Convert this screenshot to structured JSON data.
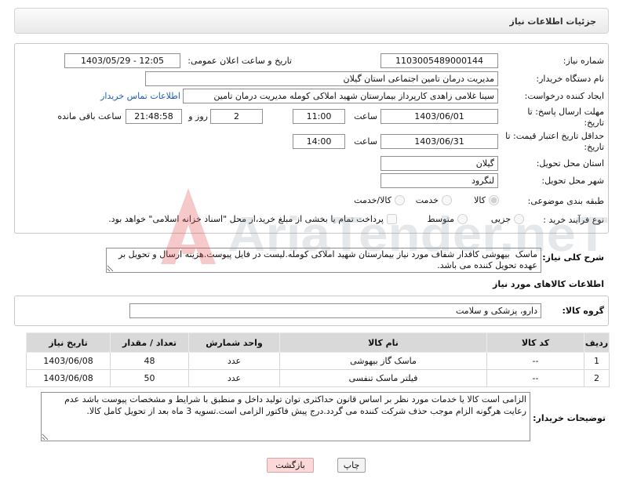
{
  "page": {
    "title": "جزئیات اطلاعات نیاز"
  },
  "colors": {
    "link": "#1a5fb4",
    "back_button_bg": "#fcd9d9",
    "header_bg": "#e9e9e9",
    "table_header_bg": "#d9d9d9"
  },
  "need_info": {
    "need_number": {
      "label": "شماره نیاز:",
      "value": "1103005489000144"
    },
    "announce": {
      "label": "تاریخ و ساعت اعلان عمومی:",
      "value": "1403/05/29 - 12:05"
    },
    "buyer_org": {
      "label": "نام دستگاه خریدار:",
      "value": "مدیریت درمان تامین اجتماعی استان گیلان"
    },
    "creator": {
      "label": "ایجاد کننده درخواست:",
      "value": "سینا غلامی زاهدی کارپرداز بیمارستان شهید املاکی کومله مدیریت درمان تامین",
      "contact_link": "اطلاعات تماس خریدار"
    },
    "deadline": {
      "label_line1": "مهلت ارسال پاسخ: تا",
      "label_line2": "تاریخ:",
      "date": "1403/06/01",
      "time_label": "ساعت",
      "time": "11:00",
      "days_remaining": "2",
      "days_label": "روز و",
      "time_remaining": "21:48:58",
      "time_remaining_label": "ساعت باقی مانده"
    },
    "price_validity": {
      "label_line1": "حداقل تاریخ اعتبار قیمت: تا",
      "label_line2": "تاریخ:",
      "date": "1403/06/31",
      "time_label": "ساعت",
      "time": "14:00"
    },
    "delivery_province": {
      "label": "استان محل تحویل:",
      "value": "گیلان"
    },
    "delivery_city": {
      "label": "شهر محل تحویل:",
      "value": "لنگرود"
    },
    "category": {
      "label": "طبقه بندی موضوعی:",
      "options": [
        {
          "label": "کالا",
          "selected": true
        },
        {
          "label": "خدمت",
          "selected": false
        },
        {
          "label": "کالا/خدمت",
          "selected": false
        }
      ]
    },
    "purchase_process": {
      "label": "نوع فرآیند خرید :",
      "options": [
        {
          "label": "جزیی",
          "selected": false
        },
        {
          "label": "متوسط",
          "selected": false
        }
      ],
      "treasury_checkbox": {
        "label": "پرداخت تمام یا بخشی از مبلغ خرید،از محل \"اسناد خزانه اسلامی\" خواهد بود.",
        "checked": false
      }
    }
  },
  "description": {
    "label": "شرح کلی نیاز:",
    "text": "ماسک  بیهوشی کافدار شفاف مورد نیاز بیمارستان شهید املاکی کومله.لیست در فایل پیوست.هزینه ارسال و تحویل بر عهده تحویل کننده می باشد."
  },
  "goods": {
    "heading": "اطلاعات کالاهای مورد نیاز",
    "group_label": "گروه کالا:",
    "group_value": "دارو، پزشکی و سلامت",
    "columns": [
      "ردیف",
      "کد کالا",
      "نام کالا",
      "واحد شمارش",
      "تعداد / مقدار",
      "تاریخ نیاز"
    ],
    "rows": [
      {
        "row": "1",
        "code": "--",
        "name": "ماسک گاز بیهوشی",
        "unit": "عدد",
        "quantity": "48",
        "need_date": "1403/06/08"
      },
      {
        "row": "2",
        "code": "--",
        "name": "فیلتر ماسک تنفسی",
        "unit": "عدد",
        "quantity": "50",
        "need_date": "1403/06/08"
      }
    ]
  },
  "buyer_notes": {
    "label": "توضیحات خریدار:",
    "text": "الزامی است کالا یا خدمات مورد نظر بر اساس قانون حداکثری توان تولید داخل و منطبق با شرایط و مشخصات پیوست باشد عدم رعایت هرگونه الزام موجب حذف شرکت کننده می گردد.درج پیش فاکتور الزامی است.تسویه 3 ماه بعد از تحویل کامل کالا."
  },
  "actions": {
    "print": "چاپ",
    "back": "بازگشت"
  },
  "watermark": {
    "text": "AriaTender.neT"
  }
}
